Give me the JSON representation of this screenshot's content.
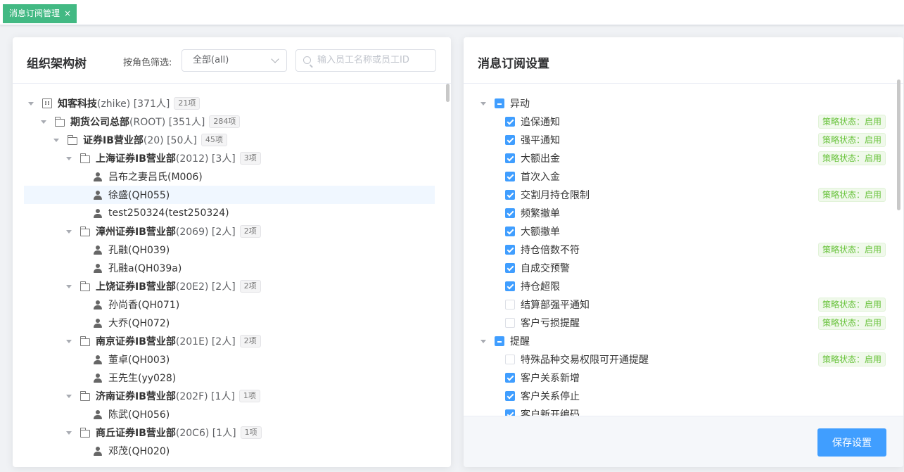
{
  "tabbar": {
    "active_tab": "消息订阅管理",
    "close_glyph": "×"
  },
  "left_panel": {
    "title": "组织架构树",
    "filter_label": "按角色筛选:",
    "role_select": "全部(all)",
    "search_placeholder": "输入员工名称或员工ID",
    "tree": [
      {
        "level": 0,
        "type": "company",
        "name": "知客科技",
        "suffix": "(zhike) [371人]",
        "badge": "21项",
        "expanded": true
      },
      {
        "level": 1,
        "type": "folder",
        "name": "期货公司总部",
        "suffix": "(ROOT) [351人]",
        "badge": "284项",
        "expanded": true
      },
      {
        "level": 2,
        "type": "folder",
        "name": "证券IB营业部",
        "suffix": "(20) [50人]",
        "badge": "45项",
        "expanded": true
      },
      {
        "level": 3,
        "type": "folder",
        "name": "上海证券IB营业部",
        "suffix": "(2012) [3人]",
        "badge": "3项",
        "expanded": true
      },
      {
        "level": 4,
        "type": "user",
        "name": "吕布之妻吕氏(M006)"
      },
      {
        "level": 4,
        "type": "user",
        "name": "徐盛(QH055)",
        "selected": true
      },
      {
        "level": 4,
        "type": "user",
        "name": "test250324(test250324)"
      },
      {
        "level": 3,
        "type": "folder",
        "name": "漳州证券IB营业部",
        "suffix": "(2069) [2人]",
        "badge": "2项",
        "expanded": true
      },
      {
        "level": 4,
        "type": "user",
        "name": "孔融(QH039)"
      },
      {
        "level": 4,
        "type": "user",
        "name": "孔融a(QH039a)"
      },
      {
        "level": 3,
        "type": "folder",
        "name": "上饶证券IB营业部",
        "suffix": "(20E2) [2人]",
        "badge": "2项",
        "expanded": true
      },
      {
        "level": 4,
        "type": "user",
        "name": "孙尚香(QH071)"
      },
      {
        "level": 4,
        "type": "user",
        "name": "大乔(QH072)"
      },
      {
        "level": 3,
        "type": "folder",
        "name": "南京证券IB营业部",
        "suffix": "(201E) [2人]",
        "badge": "2项",
        "expanded": true
      },
      {
        "level": 4,
        "type": "user",
        "name": "董卓(QH003)"
      },
      {
        "level": 4,
        "type": "user",
        "name": "王先生(yy028)"
      },
      {
        "level": 3,
        "type": "folder",
        "name": "济南证券IB营业部",
        "suffix": "(202F) [1人]",
        "badge": "1项",
        "expanded": true
      },
      {
        "level": 4,
        "type": "user",
        "name": "陈武(QH056)"
      },
      {
        "level": 3,
        "type": "folder",
        "name": "商丘证券IB营业部",
        "suffix": "(20C6) [1人]",
        "badge": "1项",
        "expanded": true
      },
      {
        "level": 4,
        "type": "user",
        "name": "邓茂(QH020)"
      }
    ]
  },
  "right_panel": {
    "title": "消息订阅设置",
    "status_text": "策略状态：启用",
    "groups": [
      {
        "label": "异动",
        "state": "indeterminate",
        "items": [
          {
            "label": "追保通知",
            "checked": true,
            "status": true
          },
          {
            "label": "强平通知",
            "checked": true,
            "status": true
          },
          {
            "label": "大额出金",
            "checked": true,
            "status": true
          },
          {
            "label": "首次入金",
            "checked": true,
            "status": false
          },
          {
            "label": "交割月持仓限制",
            "checked": true,
            "status": true
          },
          {
            "label": "频繁撤单",
            "checked": true,
            "status": false
          },
          {
            "label": "大额撤单",
            "checked": true,
            "status": false
          },
          {
            "label": "持仓倍数不符",
            "checked": true,
            "status": true
          },
          {
            "label": "自成交预警",
            "checked": true,
            "status": false
          },
          {
            "label": "持仓超限",
            "checked": true,
            "status": false
          },
          {
            "label": "结算部强平通知",
            "checked": false,
            "status": true
          },
          {
            "label": "客户亏损提醒",
            "checked": false,
            "status": true
          }
        ]
      },
      {
        "label": "提醒",
        "state": "indeterminate",
        "items": [
          {
            "label": "特殊品种交易权限可开通提醒",
            "checked": false,
            "status": true
          },
          {
            "label": "客户关系新增",
            "checked": true,
            "status": false
          },
          {
            "label": "客户关系停止",
            "checked": true,
            "status": false
          },
          {
            "label": "客户新开编码",
            "checked": true,
            "status": false
          }
        ]
      }
    ],
    "save_label": "保存设置"
  },
  "colors": {
    "accent": "#409eff",
    "tab_green": "#42b983",
    "status_green": "#67c23a"
  }
}
